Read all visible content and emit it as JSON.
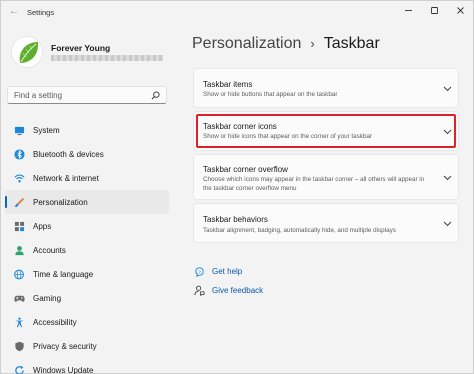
{
  "window": {
    "title": "Settings",
    "back_glyph": "←",
    "minimize_glyph": "—",
    "maximize_glyph": "☐",
    "close_glyph": "✕"
  },
  "profile": {
    "name": "Forever Young",
    "avatar_icon": "leaf-avatar"
  },
  "search": {
    "placeholder": "Find a setting"
  },
  "sidebar": {
    "accent_color": "#0067c0",
    "items": [
      {
        "label": "System",
        "icon": "monitor-icon",
        "active": false
      },
      {
        "label": "Bluetooth & devices",
        "icon": "bluetooth-icon",
        "active": false
      },
      {
        "label": "Network & internet",
        "icon": "wifi-icon",
        "active": false
      },
      {
        "label": "Personalization",
        "icon": "brush-icon",
        "active": true
      },
      {
        "label": "Apps",
        "icon": "apps-icon",
        "active": false
      },
      {
        "label": "Accounts",
        "icon": "person-icon",
        "active": false
      },
      {
        "label": "Time & language",
        "icon": "globe-clock-icon",
        "active": false
      },
      {
        "label": "Gaming",
        "icon": "gamepad-icon",
        "active": false
      },
      {
        "label": "Accessibility",
        "icon": "accessibility-icon",
        "active": false
      },
      {
        "label": "Privacy & security",
        "icon": "shield-icon",
        "active": false
      },
      {
        "label": "Windows Update",
        "icon": "update-icon",
        "active": false
      }
    ]
  },
  "main": {
    "breadcrumb_parent": "Personalization",
    "breadcrumb_sep": "›",
    "breadcrumb_current": "Taskbar",
    "cards": [
      {
        "title": "Taskbar items",
        "desc": "Show or hide buttons that appear on the taskbar"
      },
      {
        "title": "Taskbar corner icons",
        "desc": "Show or hide icons that appear on the corner of your taskbar",
        "highlighted": true
      },
      {
        "title": "Taskbar corner overflow",
        "desc": "Choose which icons may appear in the taskbar corner – all others will appear in the taskbar corner overflow menu"
      },
      {
        "title": "Taskbar behaviors",
        "desc": "Taskbar alignment, badging, automatically hide, and multiple displays"
      }
    ],
    "highlight_color": "#e0202a",
    "links": [
      {
        "label": "Get help",
        "icon": "help-icon"
      },
      {
        "label": "Give feedback",
        "icon": "feedback-icon"
      }
    ],
    "link_color": "#0a5aa8"
  }
}
